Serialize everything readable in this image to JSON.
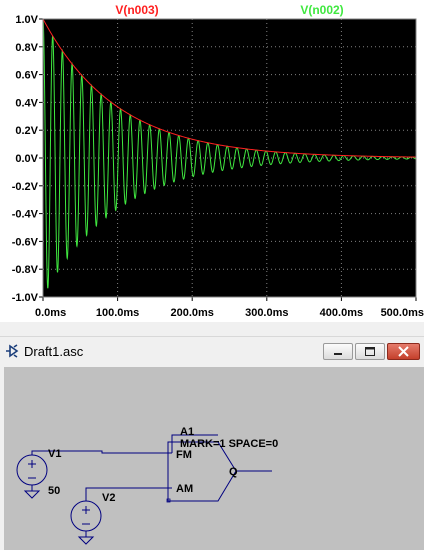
{
  "plot": {
    "traces": [
      {
        "name": "V(n003)",
        "color": "#ff2020"
      },
      {
        "name": "V(n002)",
        "color": "#40e840"
      }
    ],
    "y_ticks": [
      "1.0V",
      "0.8V",
      "0.6V",
      "0.4V",
      "0.2V",
      "0.0V",
      "-0.2V",
      "-0.4V",
      "-0.6V",
      "-0.8V",
      "-1.0V"
    ],
    "x_ticks": [
      "0.0ms",
      "100.0ms",
      "200.0ms",
      "300.0ms",
      "400.0ms",
      "500.0ms"
    ]
  },
  "chart_data": {
    "type": "line",
    "xlim": [
      0,
      500
    ],
    "ylim": [
      -1.0,
      1.0
    ],
    "x_unit": "ms",
    "y_unit": "V",
    "grid": true,
    "background": "#000000",
    "series": [
      {
        "name": "V(n003)",
        "color": "#ff2020",
        "kind": "exponential decay envelope",
        "x": [
          0,
          50,
          100,
          150,
          200,
          250,
          300,
          350,
          400,
          450,
          500
        ],
        "y": [
          1.0,
          0.6,
          0.37,
          0.22,
          0.13,
          0.08,
          0.05,
          0.03,
          0.02,
          0.01,
          0.01
        ]
      },
      {
        "name": "V(n002)",
        "color": "#40e840",
        "kind": "damped oscillation",
        "amplitude": 1.0,
        "decay_tau_ms": 100,
        "period_ms": 13,
        "x_start_ms": 0,
        "x_end_ms": 500
      }
    ]
  },
  "schematic": {
    "window_title": "Draft1.asc",
    "component": {
      "ref": "A1",
      "attrs": "MARK=1 SPACE=0",
      "pins": {
        "fm": "FM",
        "am": "AM",
        "q": "Q"
      }
    },
    "sources": [
      {
        "ref": "V1",
        "value": "50"
      },
      {
        "ref": "V2",
        "value": ""
      }
    ]
  },
  "colors": {
    "plot_bg": "#000000",
    "grid": "#808080",
    "canvas": "#c0c0c0",
    "wire": "#000080"
  }
}
